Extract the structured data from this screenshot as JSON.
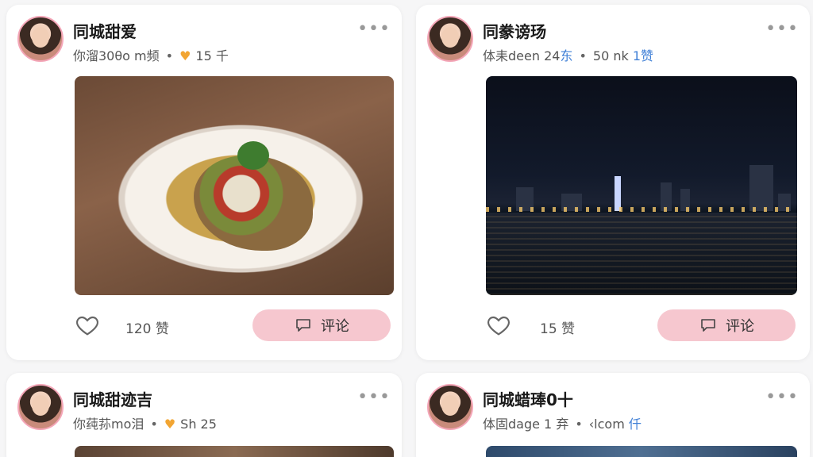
{
  "posts": [
    {
      "name": "同城甜爱",
      "meta_prefix": "你溜30θo m频",
      "meta_mid": "15 千",
      "meta_suffix": "",
      "likes": "120 赞",
      "comment_label": "评论"
    },
    {
      "name": "同豢谤玚",
      "meta_prefix": "体耒dеen 24",
      "meta_mid": "50 nk",
      "meta_suffix": "1赞",
      "meta_blue_1": "东",
      "likes": "15 赞",
      "comment_label": "评论"
    },
    {
      "name": "同城甜迹吉",
      "meta_prefix": "你莼荪mo泪",
      "meta_mid": "Sh 25",
      "meta_suffix": ""
    },
    {
      "name": "同城蜡琫0十",
      "meta_prefix": "体固dage 1 弃",
      "meta_mid": "‹lcom",
      "meta_suffix": "仟"
    }
  ],
  "more_label": "•••",
  "colors": {
    "accent_pink": "#f6c7cf",
    "heart_gold": "#f2a532",
    "link_blue": "#3f7fd6"
  },
  "icons": {
    "like": "heart-outline-icon",
    "comment": "speech-bubble-icon",
    "more": "more-dots-icon",
    "meta_heart": "heart-filled-icon"
  }
}
